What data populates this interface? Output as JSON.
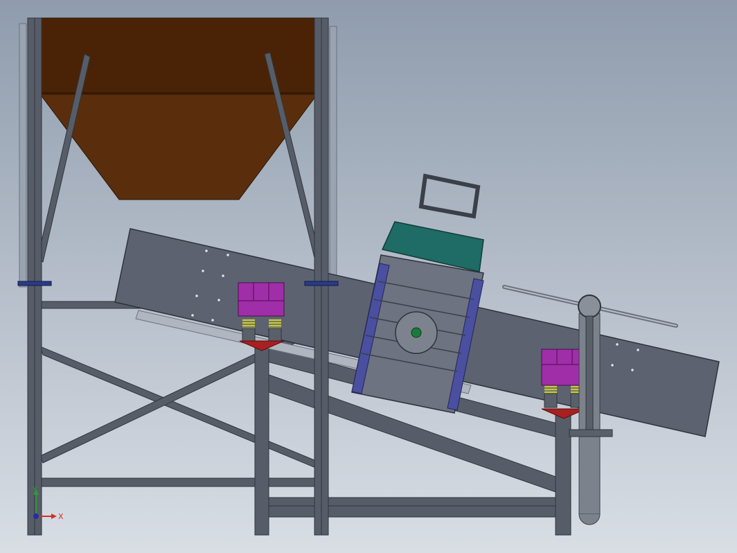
{
  "viewport": {
    "background_top": "#8f9cad",
    "background_bottom": "#d9dee5"
  },
  "triad": {
    "x_label": "X",
    "y_label": "Y",
    "x_color": "#d0302a",
    "y_color": "#2e9a3a",
    "origin_color": "#1f2fa8"
  },
  "colors": {
    "steel": "#575d68",
    "steel_dark": "#3a3f48",
    "hopper": "#5a2e0c",
    "hopper_top": "#4a2306",
    "screen_box": "#5c6270",
    "motor_frame": "#4a4fa0",
    "motor_cover": "#1f6b66",
    "damper_pad": "#a02ea8",
    "spring": "#c8c83a",
    "spout": "#a82020",
    "pipe": "#7c828c"
  }
}
